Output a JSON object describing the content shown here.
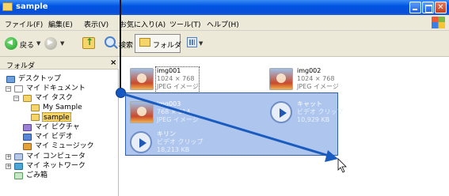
{
  "window": {
    "title": "sample"
  },
  "menu": [
    "ファイル(F)",
    "編集(E)",
    "表示(V)",
    "お気に入り(A)",
    "ツール(T)",
    "ヘルプ(H)"
  ],
  "toolbar": {
    "back": "戻る",
    "search": "検索",
    "folders": "フォルダ"
  },
  "left_pane": {
    "title": "フォルダ",
    "close": "×",
    "tree": [
      "デスクトップ",
      "マイ ドキュメント",
      "マイ タスク",
      "My Sample",
      "sample",
      "マイ ピクチャ",
      "マイ ビデオ",
      "マイ ミュージック",
      "マイ コンピュータ",
      "マイ ネットワーク",
      "ごみ箱"
    ],
    "expander_symbols": {
      "minus": "−",
      "plus": "+"
    }
  },
  "files": [
    {
      "name": "img001",
      "dims": "1024 × 768",
      "type": "JPEG イメージ"
    },
    {
      "name": "img002",
      "dims": "1024 × 768",
      "type": "JPEG イメージ"
    },
    {
      "name": "img003",
      "dims": "768 × 614",
      "type": "JPEG イメージ"
    },
    {
      "name": "キャット",
      "dims": "ビデオ クリップ",
      "type": "10,929 KB"
    },
    {
      "name": "キリン",
      "dims": "ビデオ クリップ",
      "type": "18,213 KB"
    }
  ],
  "colors": {
    "titlebar": "#0054e3",
    "selection": "#4c80d6",
    "arrow": "#1a5bbf"
  }
}
